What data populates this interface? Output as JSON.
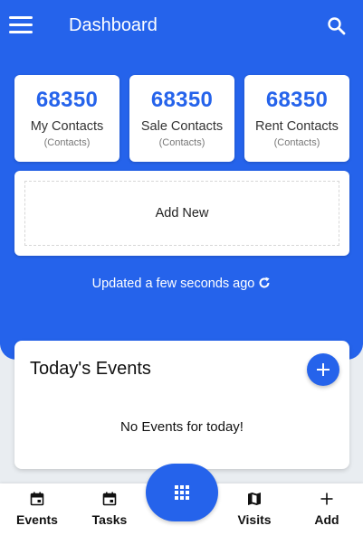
{
  "header": {
    "title": "Dashboard",
    "menu_icon": "menu-icon",
    "search_icon": "search-icon"
  },
  "stats": [
    {
      "value": "68350",
      "label": "My Contacts",
      "sub": "(Contacts)"
    },
    {
      "value": "68350",
      "label": "Sale Contacts",
      "sub": "(Contacts)"
    },
    {
      "value": "68350",
      "label": "Rent Contacts",
      "sub": "(Contacts)"
    }
  ],
  "add_new": {
    "label": "Add New"
  },
  "status": {
    "updated_text": "Updated a few seconds ago",
    "refresh_icon": "refresh-icon"
  },
  "events": {
    "title": "Today's Events",
    "empty_text": "No Events for today!",
    "add_icon": "plus-icon"
  },
  "bottom_nav": {
    "items": [
      {
        "label": "Events",
        "icon": "calendar-icon"
      },
      {
        "label": "Tasks",
        "icon": "calendar-icon"
      },
      {
        "label": "Visits",
        "icon": "map-icon"
      },
      {
        "label": "Add",
        "icon": "plus-icon"
      }
    ],
    "center_icon": "grid-icon"
  },
  "colors": {
    "primary": "#2563eb",
    "background": "#e9edf1",
    "card": "#ffffff"
  }
}
